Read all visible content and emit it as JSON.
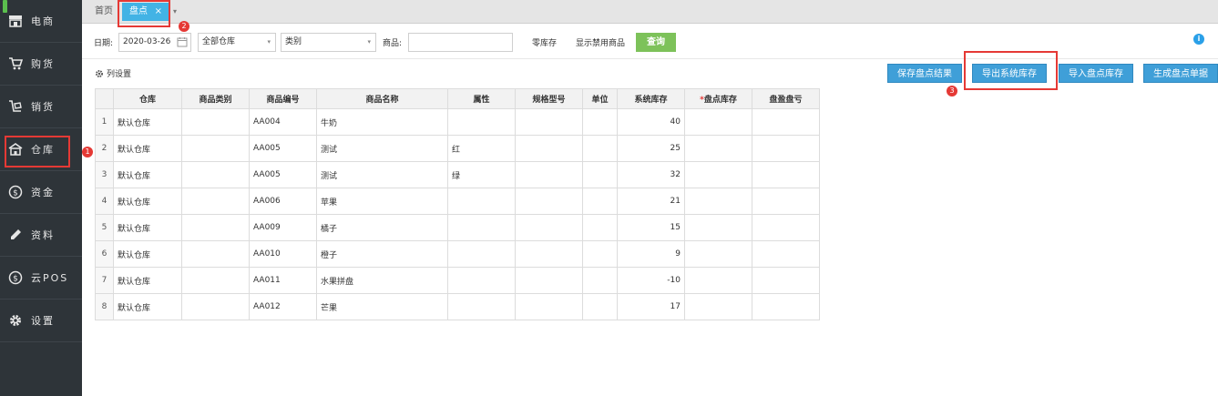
{
  "sidebar": {
    "items": [
      {
        "label": "电商",
        "icon": "store-icon"
      },
      {
        "label": "购货",
        "icon": "cart-icon"
      },
      {
        "label": "销货",
        "icon": "sales-icon"
      },
      {
        "label": "仓库",
        "icon": "warehouse-icon"
      },
      {
        "label": "资金",
        "icon": "dollar-icon"
      },
      {
        "label": "资料",
        "icon": "pen-icon"
      },
      {
        "label": "云POS",
        "icon": "pos-dollar-icon"
      },
      {
        "label": "设置",
        "icon": "gear-icon"
      }
    ]
  },
  "tabs": {
    "home": "首页",
    "active": "盘点",
    "close": "×",
    "more": "▾"
  },
  "filters": {
    "date_label": "日期:",
    "date_value": "2020-03-26",
    "warehouse_value": "全部仓库",
    "category_value": "类别",
    "product_label": "商品:",
    "product_value": "",
    "zero_stock_label": "零库存",
    "show_disabled_label": "显示禁用商品",
    "query_button": "查询",
    "caret": "▾",
    "info": "i"
  },
  "toolbar": {
    "column_settings": "列设置",
    "save_button": "保存盘点结果",
    "export_button": "导出系统库存",
    "import_button": "导入盘点库存",
    "generate_button": "生成盘点单据"
  },
  "table": {
    "headers": [
      "",
      "仓库",
      "商品类别",
      "商品编号",
      "商品名称",
      "属性",
      "规格型号",
      "单位",
      "系统库存",
      "盘点库存",
      "盘盈盘亏"
    ],
    "required_mark": "*",
    "rows": [
      {
        "idx": "1",
        "warehouse": "默认仓库",
        "category": "",
        "code": "AA004",
        "name": "牛奶",
        "attr": "",
        "spec": "",
        "unit": "",
        "stock": "40",
        "count": "",
        "diff": ""
      },
      {
        "idx": "2",
        "warehouse": "默认仓库",
        "category": "",
        "code": "AA005",
        "name": "测试",
        "attr": "红",
        "spec": "",
        "unit": "",
        "stock": "25",
        "count": "",
        "diff": ""
      },
      {
        "idx": "3",
        "warehouse": "默认仓库",
        "category": "",
        "code": "AA005",
        "name": "测试",
        "attr": "绿",
        "spec": "",
        "unit": "",
        "stock": "32",
        "count": "",
        "diff": ""
      },
      {
        "idx": "4",
        "warehouse": "默认仓库",
        "category": "",
        "code": "AA006",
        "name": "苹果",
        "attr": "",
        "spec": "",
        "unit": "",
        "stock": "21",
        "count": "",
        "diff": ""
      },
      {
        "idx": "5",
        "warehouse": "默认仓库",
        "category": "",
        "code": "AA009",
        "name": "橘子",
        "attr": "",
        "spec": "",
        "unit": "",
        "stock": "15",
        "count": "",
        "diff": ""
      },
      {
        "idx": "6",
        "warehouse": "默认仓库",
        "category": "",
        "code": "AA010",
        "name": "橙子",
        "attr": "",
        "spec": "",
        "unit": "",
        "stock": "9",
        "count": "",
        "diff": ""
      },
      {
        "idx": "7",
        "warehouse": "默认仓库",
        "category": "",
        "code": "AA011",
        "name": "水果拼盘",
        "attr": "",
        "spec": "",
        "unit": "",
        "stock": "-10",
        "count": "",
        "diff": ""
      },
      {
        "idx": "8",
        "warehouse": "默认仓库",
        "category": "",
        "code": "AA012",
        "name": "芒果",
        "attr": "",
        "spec": "",
        "unit": "",
        "stock": "17",
        "count": "",
        "diff": ""
      }
    ]
  },
  "annotations": {
    "badge_1": "1",
    "badge_2": "2",
    "badge_3": "3",
    "highlight_color": "#e53935"
  },
  "colors": {
    "sidebar_bg": "#2e3439",
    "tab_active": "#42b3e5",
    "query_button": "#7dc25a",
    "action_button": "#3f9fd8"
  }
}
